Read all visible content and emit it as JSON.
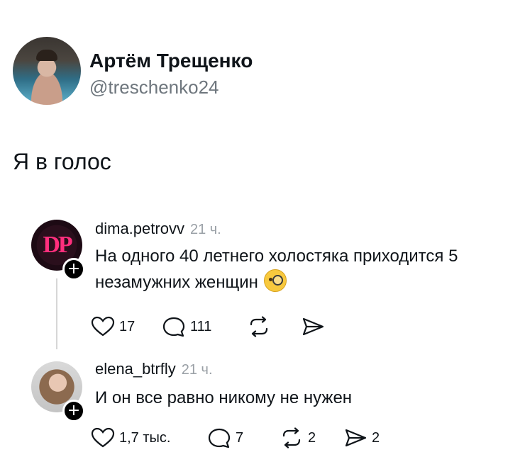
{
  "author": {
    "name": "Артём Трещенко",
    "handle": "@treschenko24",
    "avatar": "user-avatar-photo"
  },
  "post": {
    "text": "Я в голос"
  },
  "comments": [
    {
      "username": "dima.petrovv",
      "time": "21 ч.",
      "avatar_text": "DP",
      "text_line1": "На одного 40 летнего холостяка приходится 5",
      "text_line2": "незамужних женщин",
      "emoji": "face-with-monocle-emoji",
      "actions": {
        "likes": "17",
        "replies": "111",
        "reposts": "",
        "shares": ""
      }
    },
    {
      "username": "elena_btrfly",
      "time": "21 ч.",
      "text": "И он все равно никому не нужен",
      "actions": {
        "likes": "1,7 тыс.",
        "replies": "7",
        "reposts": "2",
        "shares": "2"
      }
    }
  ],
  "colors": {
    "text": "#0f1419",
    "muted": "#6e767d",
    "dp_brand": "#ff2f7d"
  }
}
